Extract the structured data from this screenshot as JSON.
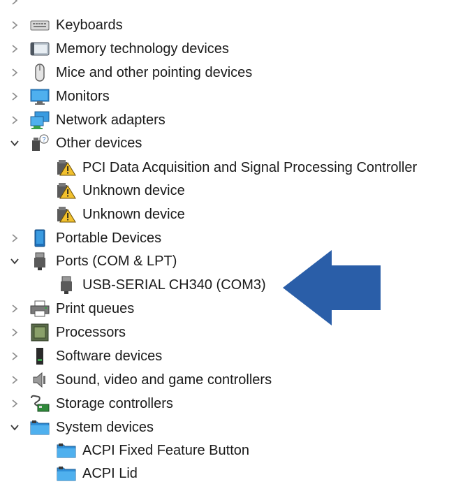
{
  "tree": {
    "top_partial_label": "",
    "categories": [
      {
        "label": "Keyboards",
        "expanded": false,
        "icon": "keyboard-icon"
      },
      {
        "label": "Memory technology devices",
        "expanded": false,
        "icon": "memory-device-icon"
      },
      {
        "label": "Mice and other pointing devices",
        "expanded": false,
        "icon": "mouse-icon"
      },
      {
        "label": "Monitors",
        "expanded": false,
        "icon": "monitor-icon"
      },
      {
        "label": "Network adapters",
        "expanded": false,
        "icon": "network-adapter-icon"
      },
      {
        "label": "Other devices",
        "expanded": true,
        "icon": "other-devices-icon",
        "children": [
          {
            "label": "PCI Data Acquisition and Signal Processing Controller",
            "icon": "unknown-device-warning-icon"
          },
          {
            "label": "Unknown device",
            "icon": "unknown-device-warning-icon"
          },
          {
            "label": "Unknown device",
            "icon": "unknown-device-warning-icon"
          }
        ]
      },
      {
        "label": "Portable Devices",
        "expanded": false,
        "icon": "portable-device-icon"
      },
      {
        "label": "Ports (COM & LPT)",
        "expanded": true,
        "icon": "port-icon",
        "children": [
          {
            "label": "USB-SERIAL CH340 (COM3)",
            "icon": "usb-serial-port-icon"
          }
        ]
      },
      {
        "label": "Print queues",
        "expanded": false,
        "icon": "printer-icon"
      },
      {
        "label": "Processors",
        "expanded": false,
        "icon": "processor-icon"
      },
      {
        "label": "Software devices",
        "expanded": false,
        "icon": "software-device-icon"
      },
      {
        "label": "Sound, video and game controllers",
        "expanded": false,
        "icon": "speaker-icon"
      },
      {
        "label": "Storage controllers",
        "expanded": false,
        "icon": "storage-controller-icon"
      },
      {
        "label": "System devices",
        "expanded": true,
        "icon": "system-devices-icon",
        "children": [
          {
            "label": "ACPI Fixed Feature Button",
            "icon": "system-device-folder-icon"
          },
          {
            "label": "ACPI Lid",
            "icon": "system-device-folder-icon"
          }
        ]
      }
    ]
  },
  "annotation": {
    "icon": "pointer-arrow-icon",
    "color": "#2a5ea8"
  }
}
